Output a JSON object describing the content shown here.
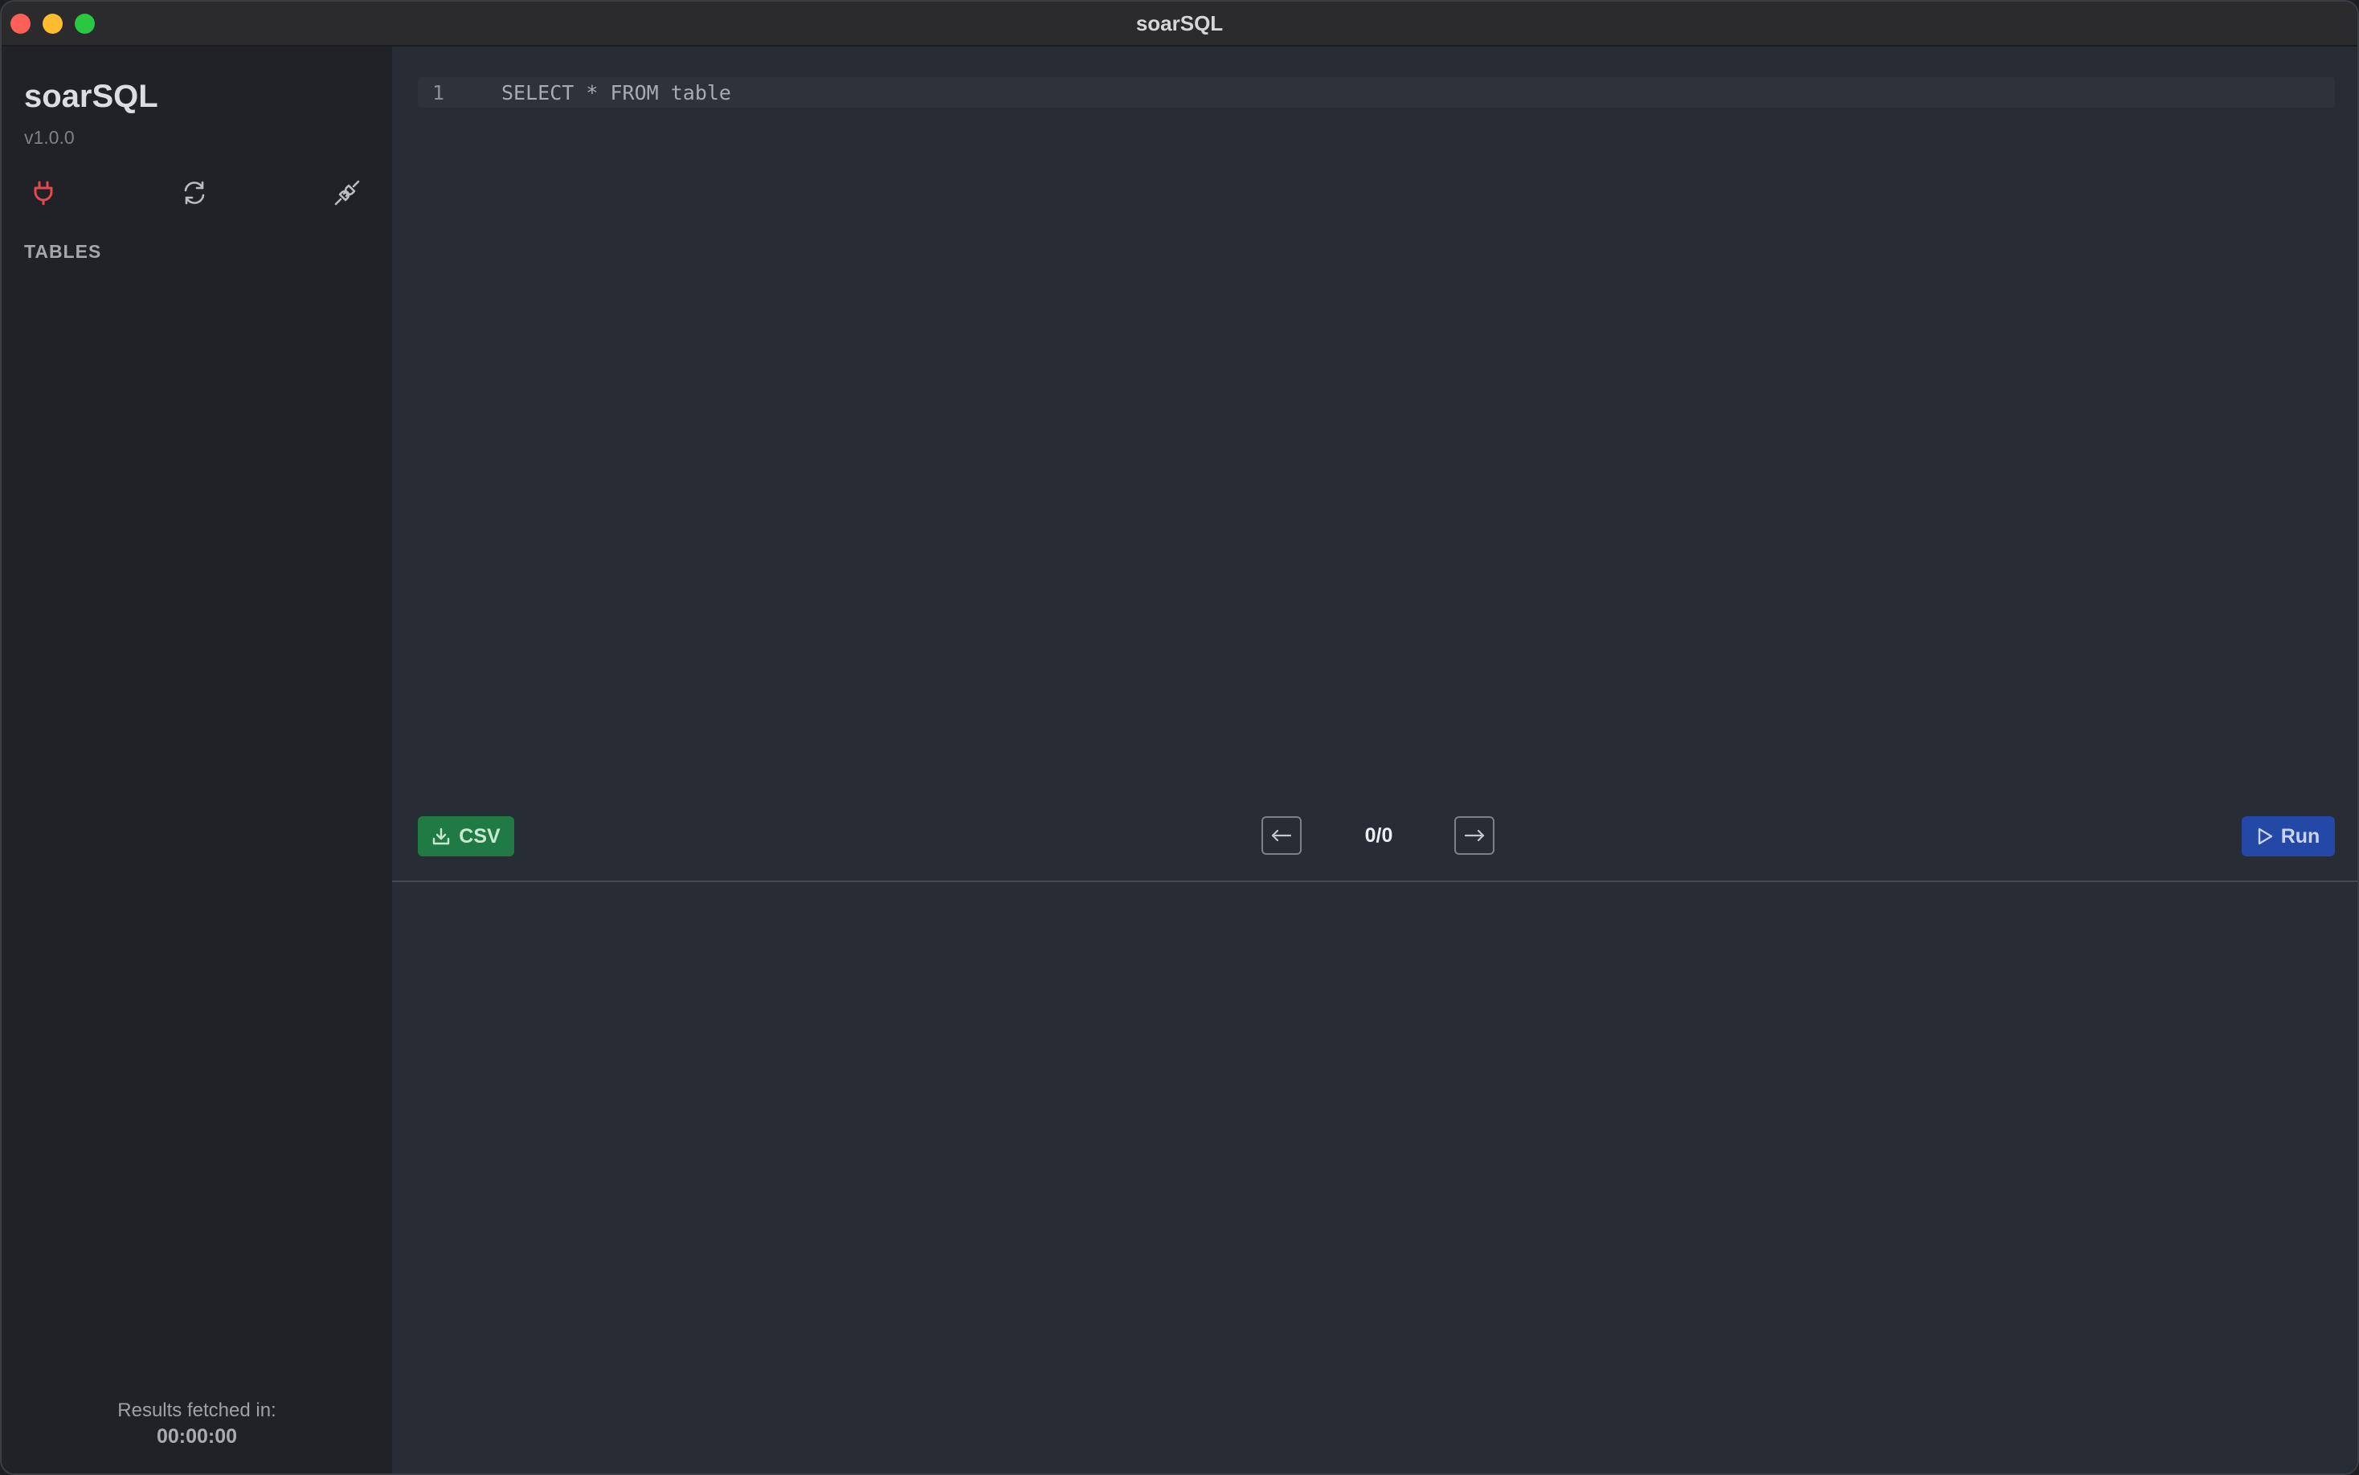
{
  "window": {
    "title": "soarSQL"
  },
  "sidebar": {
    "app_name": "soarSQL",
    "version": "v1.0.0",
    "icons": {
      "connect": "plug-icon",
      "refresh": "refresh-icon",
      "disconnect": "disconnect-icon"
    },
    "tables_label": "TABLES",
    "tables": [],
    "fetch_label": "Results fetched in:",
    "fetch_time": "00:00:00"
  },
  "editor": {
    "lines": [
      {
        "number": "1",
        "text": "SELECT * FROM table"
      }
    ]
  },
  "toolbar": {
    "csv_label": "CSV",
    "run_label": "Run",
    "pagination": "0/0"
  },
  "colors": {
    "connect_icon": "#e5484d",
    "csv_button": "#1f7a44",
    "run_button": "#2448a5"
  }
}
